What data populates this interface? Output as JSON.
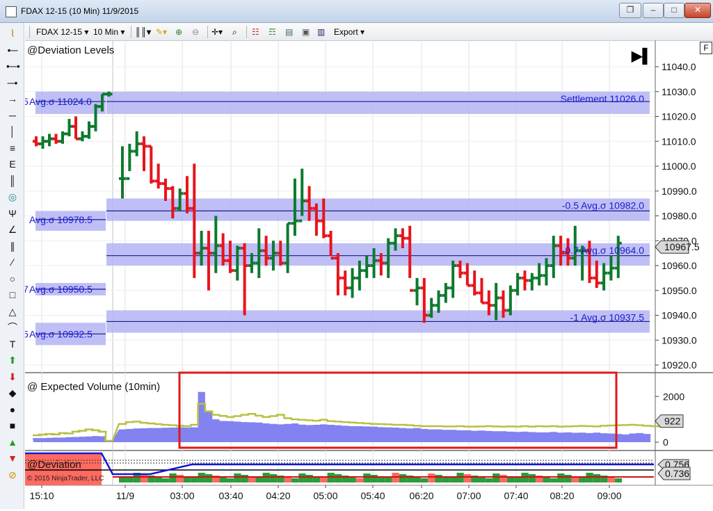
{
  "window": {
    "title": "FDAX 12-15 (10 Min)  11/9/2015",
    "restore_glyph": "❐",
    "minimize_glyph": "–",
    "maximize_glyph": "□",
    "close_glyph": "✕"
  },
  "toolbar": {
    "instrument": "FDAX 12-15",
    "interval": "10 Min",
    "export_label": "Export",
    "dropdown_glyph": "▾"
  },
  "drawing_tools": [
    {
      "icon": "ruler-icon",
      "glyph": "⌇"
    },
    {
      "icon": "dot-line-icon",
      "glyph": "•─"
    },
    {
      "icon": "extended-line-icon",
      "glyph": "•─•"
    },
    {
      "icon": "line-icon",
      "glyph": "─•"
    },
    {
      "icon": "arrow-line-icon",
      "glyph": "→"
    },
    {
      "icon": "horizontal-line-icon",
      "glyph": "─"
    },
    {
      "icon": "vertical-line-icon",
      "glyph": "│"
    },
    {
      "icon": "fibonacci-icon",
      "glyph": "≡"
    },
    {
      "icon": "fib-extension-icon",
      "glyph": "E"
    },
    {
      "icon": "fib-time-icon",
      "glyph": "║"
    },
    {
      "icon": "fib-circle-icon",
      "glyph": "◎"
    },
    {
      "icon": "andrews-pitchfork-icon",
      "glyph": "Ψ"
    },
    {
      "icon": "gann-fan-icon",
      "glyph": "∠"
    },
    {
      "icon": "regression-channel-icon",
      "glyph": "∥"
    },
    {
      "icon": "trend-channel-icon",
      "glyph": "∕"
    },
    {
      "icon": "ellipse-icon",
      "glyph": "○"
    },
    {
      "icon": "rectangle-icon",
      "glyph": "□"
    },
    {
      "icon": "triangle-icon",
      "glyph": "△"
    },
    {
      "icon": "arc-icon",
      "glyph": "⌒"
    },
    {
      "icon": "text-icon",
      "glyph": "T"
    },
    {
      "icon": "arrow-up-icon",
      "glyph": "⬆"
    },
    {
      "icon": "arrow-down-icon",
      "glyph": "⬇"
    },
    {
      "icon": "diamond-icon",
      "glyph": "◆"
    },
    {
      "icon": "dot-icon",
      "glyph": "●"
    },
    {
      "icon": "square-icon",
      "glyph": "■"
    },
    {
      "icon": "triangle-up-icon",
      "glyph": "▲"
    },
    {
      "icon": "triangle-down-icon",
      "glyph": "▼"
    },
    {
      "icon": "eraser-icon",
      "glyph": "⊘"
    }
  ],
  "colors": {
    "up_bar": "#0d7a2e",
    "down_bar": "#e8141c",
    "band": "#b4b4f5",
    "level_line": "#1a1a8c",
    "level_text": "#1a1ad0",
    "volume_fill": "#8282f0",
    "volume_expected": "#b8c040",
    "highlight": "#e01818",
    "deviation_blue": "#1515d8",
    "deviation_red": "#ff6a60",
    "deviation_green": "#2e9a3a"
  },
  "panels": {
    "price": {
      "title": "@Deviation Levels",
      "f_button": "F",
      "jump_glyph": "▶▌",
      "y_min": 10915,
      "y_max": 11045,
      "price_ticks": [
        "11040.0",
        "11030.0",
        "11020.0",
        "11010.0",
        "11000.0",
        "10990.0",
        "10980.0",
        "10970.0",
        "10960.0",
        "10950.0",
        "10940.0",
        "10930.0",
        "10920.0"
      ],
      "current_price": "10967.5",
      "levels": [
        {
          "label": "Avg.σ 11024.0",
          "glyph": "5",
          "price": 11026,
          "band_lo": 11021,
          "band_hi": 11030,
          "segment": "prior",
          "label_side": "left"
        },
        {
          "label": "Avg.σ 10978.5",
          "glyph": "",
          "price": 10978.5,
          "band_lo": 10974,
          "band_hi": 10982,
          "segment": "prior",
          "label_side": "left"
        },
        {
          "label": "Avg.σ 10950.5",
          "glyph": "7",
          "price": 10950.5,
          "band_lo": 10948,
          "band_hi": 10953,
          "segment": "prior",
          "label_side": "left"
        },
        {
          "label": "Avg.σ 10932.5",
          "glyph": "5",
          "price": 10932.5,
          "band_lo": 10928,
          "band_hi": 10937,
          "segment": "prior",
          "label_side": "left"
        },
        {
          "label": "Settlement 11026.0",
          "glyph": "",
          "price": 11026,
          "band_lo": 11021,
          "band_hi": 11030,
          "segment": "current",
          "label_side": "right"
        },
        {
          "label": "-0.5 Avg.σ 10982.0",
          "glyph": "",
          "price": 10982,
          "band_lo": 10978,
          "band_hi": 10987,
          "segment": "current",
          "label_side": "right"
        },
        {
          "label": "-0.7 Avg.σ 10964.0",
          "glyph": "",
          "price": 10964,
          "band_lo": 10960,
          "band_hi": 10969,
          "segment": "current",
          "label_side": "right"
        },
        {
          "label": "-1 Avg.σ 10937.5",
          "glyph": "",
          "price": 10937.5,
          "band_lo": 10933,
          "band_hi": 10942,
          "segment": "current",
          "label_side": "right"
        }
      ]
    },
    "volume": {
      "title": "@ Expected Volume (10min)",
      "ticks": [
        "2000",
        "0"
      ],
      "v_max": 2800,
      "current_value": "922"
    },
    "deviation": {
      "title": "@Deviation",
      "copyright": "© 2015 NinjaTrader, LLC",
      "value_top": "0.756",
      "current_value": "0.736"
    }
  },
  "time_axis": [
    "15:10",
    "11/9",
    "03:00",
    "03:40",
    "04:20",
    "05:00",
    "05:40",
    "06:20",
    "07:00",
    "07:40",
    "08:20",
    "09:00"
  ],
  "chart_data": {
    "type": "ohlc",
    "series": [
      {
        "name": "FDAX 12-15",
        "values": [
          [
            11010,
            11012,
            11008,
            11009
          ],
          [
            11009,
            11012,
            11007,
            11010
          ],
          [
            11010,
            11013,
            11008,
            11011
          ],
          [
            11011,
            11013,
            11009,
            11010
          ],
          [
            11010,
            11014,
            11009,
            11013
          ],
          [
            11013,
            11019,
            11012,
            11016
          ],
          [
            11016,
            11020,
            11011,
            11011
          ],
          [
            11011,
            11014,
            11010,
            11012
          ],
          [
            11012,
            11018,
            11011,
            11016
          ],
          [
            11016,
            11025,
            11014,
            11024
          ],
          [
            11024,
            11029,
            11022,
            11029
          ],
          [
            11029,
            11030,
            11028,
            11029
          ],
          [
            10995,
            11008,
            10987,
            10995
          ],
          [
            10995,
            11009,
            10998,
            11006
          ],
          [
            11006,
            11014,
            11004,
            11009
          ],
          [
            11009,
            11012,
            10998,
            11008
          ],
          [
            11008,
            11008,
            10993,
            10994
          ],
          [
            10994,
            11001,
            10991,
            10993
          ],
          [
            10993,
            10995,
            10986,
            10991
          ],
          [
            10991,
            10992,
            10979,
            10983
          ],
          [
            10983,
            10991,
            10982,
            10989
          ],
          [
            10989,
            10996,
            10981,
            10983
          ],
          [
            10983,
            11001,
            10955,
            10965
          ],
          [
            10965,
            10974,
            10960,
            10967
          ],
          [
            10967,
            10974,
            10950,
            10965
          ],
          [
            10965,
            10980,
            10957,
            10968
          ],
          [
            10968,
            10973,
            10960,
            10962
          ],
          [
            10962,
            10970,
            10957,
            10958
          ],
          [
            10958,
            10968,
            10954,
            10967
          ],
          [
            10967,
            10969,
            10940,
            10960
          ],
          [
            10960,
            10965,
            10957,
            10961
          ],
          [
            10961,
            10975,
            10955,
            10966
          ],
          [
            10966,
            10972,
            10960,
            10963
          ],
          [
            10963,
            10970,
            10958,
            10965
          ],
          [
            10965,
            10970,
            10960,
            10961
          ],
          [
            10961,
            10977,
            10957,
            10977
          ],
          [
            10977,
            10995,
            10972,
            10978
          ],
          [
            10978,
            10999,
            10980,
            10986
          ],
          [
            10986,
            10992,
            10978,
            10983
          ],
          [
            10983,
            10985,
            10972,
            10978
          ],
          [
            10978,
            10987,
            10971,
            10972
          ],
          [
            10972,
            10974,
            10964,
            10963
          ],
          [
            10963,
            10965,
            10948,
            10955
          ],
          [
            10955,
            10958,
            10948,
            10951
          ],
          [
            10951,
            10959,
            10947,
            10955
          ],
          [
            10955,
            10962,
            10950,
            10958
          ],
          [
            10958,
            10964,
            10955,
            10960
          ],
          [
            10960,
            10967,
            10955,
            10962
          ],
          [
            10962,
            10965,
            10956,
            10961
          ],
          [
            10961,
            10971,
            10955,
            10969
          ],
          [
            10969,
            10975,
            10966,
            10972
          ],
          [
            10972,
            10975,
            10967,
            10971
          ],
          [
            10971,
            10976,
            10955,
            10950
          ],
          [
            10950,
            10955,
            10944,
            10951
          ],
          [
            10951,
            10955,
            10937,
            10940
          ],
          [
            10940,
            10947,
            10939,
            10944
          ],
          [
            10944,
            10950,
            10941,
            10948
          ],
          [
            10948,
            10953,
            10945,
            10951
          ],
          [
            10951,
            10962,
            10947,
            10960
          ],
          [
            10960,
            10962,
            10955,
            10957
          ],
          [
            10957,
            10961,
            10952,
            10952
          ],
          [
            10952,
            10958,
            10948,
            10949
          ],
          [
            10949,
            10955,
            10945,
            10945
          ],
          [
            10945,
            10950,
            10940,
            10944
          ],
          [
            10944,
            10953,
            10938,
            10947
          ],
          [
            10947,
            10950,
            10939,
            10942
          ],
          [
            10942,
            10952,
            10940,
            10950
          ],
          [
            10950,
            10957,
            10948,
            10955
          ],
          [
            10955,
            10958,
            10950,
            10954
          ],
          [
            10954,
            10957,
            10950,
            10955
          ],
          [
            10955,
            10961,
            10952,
            10956
          ],
          [
            10956,
            10963,
            10952,
            10960
          ],
          [
            10960,
            10972,
            10955,
            10968
          ],
          [
            10968,
            10972,
            10960,
            10965
          ],
          [
            10965,
            10971,
            10960,
            10963
          ],
          [
            10963,
            10976,
            10960,
            10966
          ],
          [
            10966,
            10968,
            10954,
            10966
          ],
          [
            10966,
            10970,
            10953,
            10955
          ],
          [
            10955,
            10962,
            10951,
            10953
          ],
          [
            10953,
            10961,
            10950,
            10957
          ],
          [
            10957,
            10964,
            10954,
            10959
          ],
          [
            10959,
            10972,
            10955,
            10969
          ]
        ]
      },
      {
        "name": "Expected Volume",
        "values": [
          180,
          180,
          190,
          200,
          200,
          220,
          230,
          240,
          250,
          270,
          260,
          60,
          560,
          580,
          600,
          610,
          620,
          620,
          630,
          640,
          650,
          640,
          650,
          2200,
          1330,
          1000,
          930,
          920,
          900,
          880,
          870,
          860,
          820,
          800,
          780,
          800,
          820,
          770,
          750,
          760,
          780,
          760,
          740,
          720,
          700,
          700,
          690,
          680,
          660,
          650,
          640,
          620,
          600,
          620,
          580,
          560,
          560,
          540,
          540,
          520,
          520,
          500,
          510,
          490,
          480,
          480,
          460,
          450,
          460,
          440,
          430,
          430,
          450,
          420,
          430,
          410,
          420,
          400,
          420,
          390,
          380,
          360,
          340,
          380,
          400,
          360
        ]
      },
      {
        "name": "Expected",
        "values": [
          300,
          330,
          360,
          340,
          400,
          380,
          460,
          500,
          560,
          520,
          460,
          60,
          800,
          880,
          900,
          850,
          820,
          790,
          760,
          740,
          720,
          700,
          760,
          1680,
          1350,
          1200,
          1150,
          1100,
          1140,
          1200,
          1240,
          1160,
          1100,
          1140,
          1200,
          1050,
          1000,
          980,
          960,
          940,
          980,
          920,
          900,
          880,
          860,
          840,
          820,
          800,
          790,
          780,
          760,
          760,
          740,
          720,
          700,
          700,
          700,
          690,
          690,
          700,
          680,
          680,
          690,
          700,
          690,
          680,
          690,
          680,
          700,
          680,
          700,
          690,
          700,
          680,
          690,
          700,
          710,
          700,
          690,
          720,
          730,
          740,
          750,
          760,
          740,
          720,
          700,
          690
        ]
      }
    ]
  }
}
